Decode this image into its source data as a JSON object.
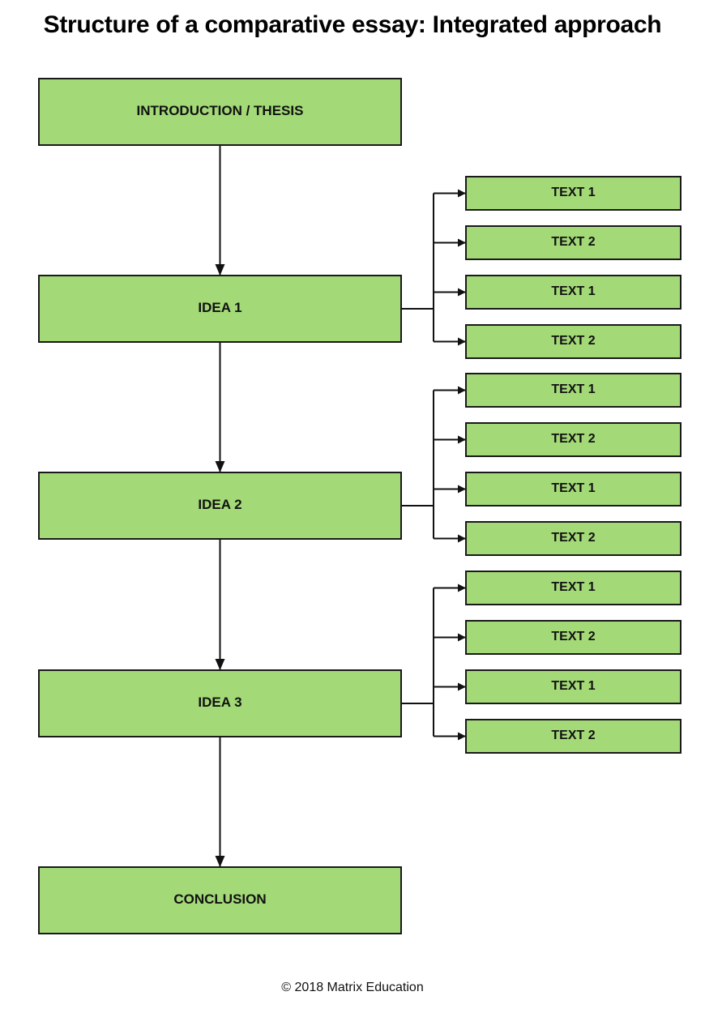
{
  "title": "Structure of a comparative essay: Integrated approach",
  "colors": {
    "box_fill": "#a3d977",
    "box_stroke": "#1a1a1a",
    "connector": "#111111"
  },
  "main_flow": [
    {
      "id": "intro",
      "label": "INTRODUCTION / THESIS"
    },
    {
      "id": "idea1",
      "label": "IDEA 1",
      "branches": [
        "TEXT 1",
        "TEXT 2",
        "TEXT 1",
        "TEXT 2"
      ]
    },
    {
      "id": "idea2",
      "label": "IDEA 2",
      "branches": [
        "TEXT 1",
        "TEXT 2",
        "TEXT 1",
        "TEXT 2"
      ]
    },
    {
      "id": "idea3",
      "label": "IDEA 3",
      "branches": [
        "TEXT 1",
        "TEXT 2",
        "TEXT 1",
        "TEXT 2"
      ]
    },
    {
      "id": "conclusion",
      "label": "CONCLUSION"
    }
  ],
  "footer": "© 2018 Matrix Education"
}
